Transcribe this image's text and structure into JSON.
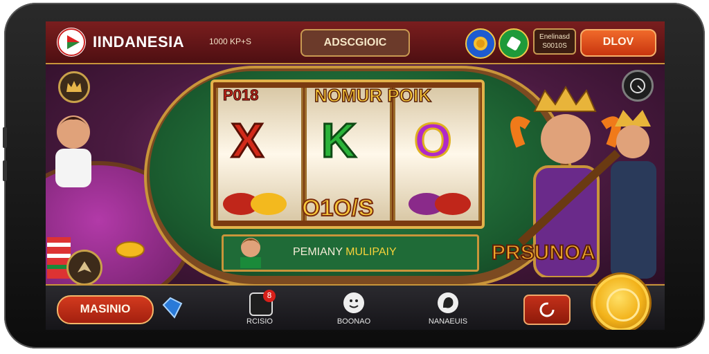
{
  "header": {
    "brand": "IINDANESIA",
    "subinfo": "1000 KP+S",
    "center_label": "ADSCGIOIC",
    "balance_line1": "Enelinasd",
    "balance_line2": "S0010S",
    "play_label": "DLOV"
  },
  "game": {
    "reel_top": "NOMUR POIK",
    "reel_top_left": "P018",
    "symbols": [
      "X",
      "K",
      "O"
    ],
    "win_text": "O1O/S",
    "promo_left": "PEMIANY ",
    "promo_right": "MULIPAIY",
    "side_text": "PRSUNOA"
  },
  "bottom_nav": {
    "main_button": "MASINIO",
    "items": [
      {
        "label": "RCISIO",
        "badge": "8"
      },
      {
        "label": "BOONAO"
      },
      {
        "label": "NANAEUIS"
      }
    ]
  },
  "colors": {
    "accent_gold": "#c9953a",
    "header_red": "#7a1e1e",
    "button_orange": "#f06a2a",
    "reel_green": "#2f8a4a"
  },
  "icons": [
    "play-logo-icon",
    "coin-rocket-icon",
    "green-badge-icon",
    "crown-icon",
    "clock-icon",
    "spade-chip-icon",
    "diamond-icon",
    "slot-phone-icon",
    "smiley-icon",
    "face-icon",
    "refresh-icon",
    "gold-coin-icon"
  ]
}
